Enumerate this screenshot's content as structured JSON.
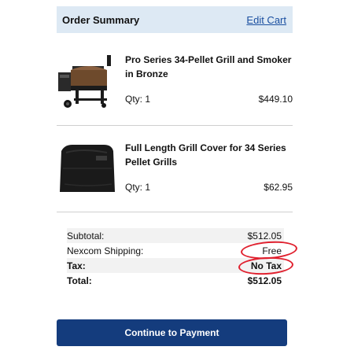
{
  "order_summary": {
    "title": "Order Summary",
    "edit_cart_label": "Edit Cart"
  },
  "items": [
    {
      "name": "Pro Series 34-Pellet Grill and Smoker in Bronze",
      "qty_text": "Qty: 1",
      "price": "$449.10",
      "thumbnail": "pellet-grill-image"
    },
    {
      "name": "Full Length Grill Cover for 34 Series Pellet Grills",
      "qty_text": "Qty: 1",
      "price": "$62.95",
      "thumbnail": "grill-cover-image"
    }
  ],
  "totals": {
    "subtotal_label": "Subtotal:",
    "subtotal_value": "$512.05",
    "shipping_label": "Nexcom Shipping:",
    "shipping_value": "Free",
    "tax_label": "Tax:",
    "tax_value": "No Tax",
    "total_label": "Total:",
    "total_value": "$512.05"
  },
  "continue_button_label": "Continue to Payment",
  "colors": {
    "header_bg": "#dde9f4",
    "link": "#1a4fa0",
    "button": "#143c7d",
    "annotation": "#e0202e"
  }
}
